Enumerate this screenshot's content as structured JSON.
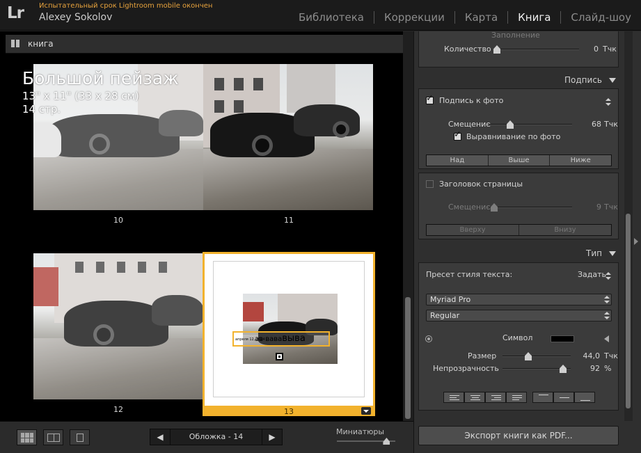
{
  "app": {
    "logo": "Lr",
    "trial_notice": "Испытательный срок Lightroom mobile окончен",
    "user_name": "Alexey Sokolov",
    "modules": [
      {
        "label": "Библиотека",
        "active": false
      },
      {
        "label": "Коррекции",
        "active": false
      },
      {
        "label": "Карта",
        "active": false
      },
      {
        "label": "Книга",
        "active": true
      },
      {
        "label": "Слайд-шоу",
        "active": false
      }
    ]
  },
  "breadcrumb": {
    "icon": "panel-toggle-icon",
    "label": "книга"
  },
  "book": {
    "title": "Большой пейзаж",
    "size": "13\" x 11\" (33 x 28 см)",
    "pages": "14 стр."
  },
  "pages": [
    {
      "number": "10"
    },
    {
      "number": "11"
    },
    {
      "number": "12"
    },
    {
      "number": "13",
      "selected": true,
      "caption_small": "апреля 12, 2014",
      "caption_mid": "ав вава",
      "caption_big": "выва"
    }
  ],
  "toolbar": {
    "nav_prev": "◀",
    "nav_label": "Обложка - 14",
    "nav_next": "▶",
    "thumbnails_label": "Миниатюры",
    "thumbnails_value": 0.85
  },
  "right": {
    "fill_label": "Заполнение",
    "count_label": "Количество",
    "count_value": "0",
    "count_unit": "Тчк",
    "caption_section": "Подпись",
    "photo_caption": {
      "label": "Подпись к фото",
      "checked": true
    },
    "offset_label": "Смещение",
    "offset_value": "68",
    "offset_unit": "Тчк",
    "align_to_photo": {
      "label": "Выравнивание по фото",
      "checked": true
    },
    "position_buttons": [
      "Над",
      "Выше",
      "Ниже"
    ],
    "page_header": {
      "label": "Заголовок страницы",
      "checked": false
    },
    "header_offset_label": "Смещение",
    "header_offset_value": "9",
    "header_offset_unit": "Тчк",
    "header_position_buttons": [
      "Вверху",
      "Внизу"
    ],
    "type_section": "Тип",
    "text_preset_label": "Пресет стиля текста:",
    "text_preset_value": "Задать",
    "font_family": "Myriad Pro",
    "font_style": "Regular",
    "symbol_label": "Символ",
    "symbol_color": "#000000",
    "size_label": "Размер",
    "size_value": "44,0",
    "size_unit": "Тчк",
    "opacity_label": "Непрозрачность",
    "opacity_value": "92",
    "opacity_unit": "%",
    "export_button": "Экспорт книги как PDF..."
  },
  "colors": {
    "selection": "#f2b22d",
    "trial": "#e8a33d"
  }
}
